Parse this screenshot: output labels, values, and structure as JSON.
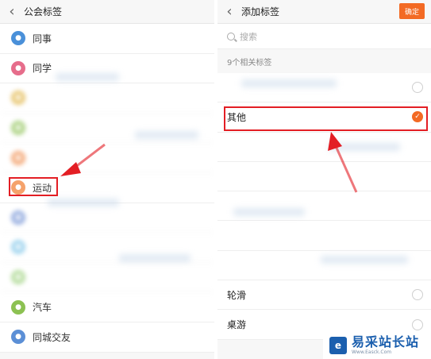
{
  "left_panel": {
    "header": {
      "title": "公会标签"
    },
    "items": [
      {
        "label": "同事",
        "icon": "colleague-icon",
        "color": "#4a90d9",
        "blurred": false
      },
      {
        "label": "同学",
        "icon": "classmate-icon",
        "color": "#e66d8b",
        "blurred": false
      },
      {
        "label": "",
        "icon": "tag-icon",
        "color": "#e0b23f",
        "blurred": true
      },
      {
        "label": "",
        "icon": "tag-icon",
        "color": "#8cc152",
        "blurred": true
      },
      {
        "label": "",
        "icon": "tag-icon",
        "color": "#f08b4a",
        "blurred": true
      },
      {
        "label": "运动",
        "icon": "sports-icon",
        "color": "#f5a26b",
        "blurred": false
      },
      {
        "label": "",
        "icon": "tag-icon",
        "color": "#6f8fd4",
        "blurred": true
      },
      {
        "label": "",
        "icon": "tag-icon",
        "color": "#7cc4e8",
        "blurred": true
      },
      {
        "label": "",
        "icon": "tag-icon",
        "color": "#9bd07b",
        "blurred": true
      },
      {
        "label": "汽车",
        "icon": "car-icon",
        "color": "#8cc152",
        "blurred": false
      },
      {
        "label": "同城交友",
        "icon": "local-friends-icon",
        "color": "#5b8fd6",
        "blurred": false
      }
    ]
  },
  "right_panel": {
    "header": {
      "title": "添加标签",
      "confirm_label": "确定"
    },
    "search": {
      "placeholder": "搜索"
    },
    "count_label": "9个相关标签",
    "items": [
      {
        "label": "",
        "checked": false,
        "blurred": true
      },
      {
        "label": "其他",
        "checked": true,
        "blurred": false
      },
      {
        "label": "",
        "checked": false,
        "blurred": true
      },
      {
        "label": "",
        "checked": false,
        "blurred": true
      },
      {
        "label": "",
        "checked": false,
        "blurred": true
      },
      {
        "label": "",
        "checked": false,
        "blurred": true
      },
      {
        "label": "",
        "checked": false,
        "blurred": true
      },
      {
        "label": "轮滑",
        "checked": false,
        "blurred": false
      },
      {
        "label": "桌游",
        "checked": false,
        "blurred": false
      }
    ]
  },
  "watermark": {
    "logo_glyph": "e",
    "title": "易采站长站",
    "subtitle": "Www.Easck.Com"
  },
  "colors": {
    "accent": "#f36a24",
    "highlight": "#e31e24",
    "brand_blue": "#1b5fae"
  }
}
